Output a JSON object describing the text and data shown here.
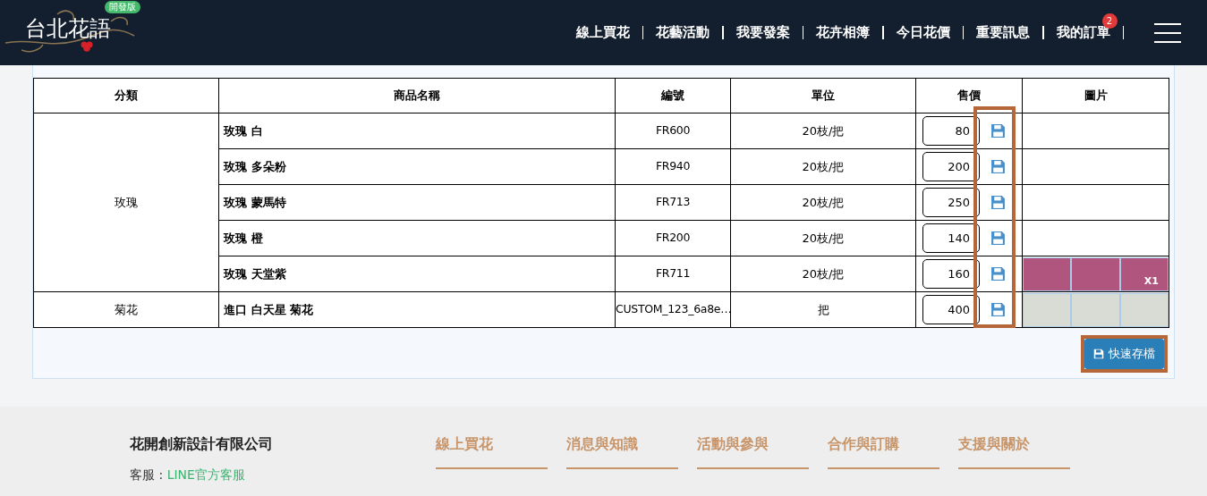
{
  "header": {
    "logo": {
      "text": "台北花語",
      "badge": "開發版"
    },
    "nav": [
      {
        "label": "線上買花"
      },
      {
        "label": "花藝活動"
      },
      {
        "label": "我要發案"
      },
      {
        "label": "花卉相簿"
      },
      {
        "label": "今日花價"
      },
      {
        "label": "重要訊息"
      },
      {
        "label": "我的訂單",
        "badge": "2"
      }
    ]
  },
  "table": {
    "columns": [
      "分類",
      "商品名稱",
      "編號",
      "單位",
      "售價",
      "圖片"
    ],
    "groups": [
      {
        "category": "玫瑰",
        "rows": [
          {
            "name": "玫瑰 白",
            "code": "FR600",
            "unit": "20枝/把",
            "price": "80",
            "photos": []
          },
          {
            "name": "玫瑰 多朵粉",
            "code": "FR940",
            "unit": "20枝/把",
            "price": "200",
            "photos": []
          },
          {
            "name": "玫瑰 蒙馬特",
            "code": "FR713",
            "unit": "20枝/把",
            "price": "250",
            "photos": []
          },
          {
            "name": "玫瑰 橙",
            "code": "FR200",
            "unit": "20枝/把",
            "price": "140",
            "photos": []
          },
          {
            "name": "玫瑰 天堂紫",
            "code": "FR711",
            "unit": "20枝/把",
            "price": "160",
            "photos": [
              {
                "kind": "rose"
              },
              {
                "kind": "rose"
              },
              {
                "kind": "rose",
                "badge": "X1"
              }
            ]
          }
        ]
      },
      {
        "category": "菊花",
        "rows": [
          {
            "name": "進口 白天星 菊花",
            "code": "CUSTOM_123_6a8e…",
            "unit": "把",
            "price": "400",
            "photos": [
              {
                "kind": "white-flower"
              },
              {
                "kind": "white-flower"
              },
              {
                "kind": "white-flower"
              }
            ]
          }
        ]
      }
    ]
  },
  "quick_save": {
    "label": "快速存檔"
  },
  "footer": {
    "company": "花開創新設計有限公司",
    "service_label": "客服 :",
    "service_link": "LINE官方客服",
    "columns": [
      "線上買花",
      "消息與知識",
      "活動與參與",
      "合作與訂購",
      "支援與關於"
    ]
  }
}
